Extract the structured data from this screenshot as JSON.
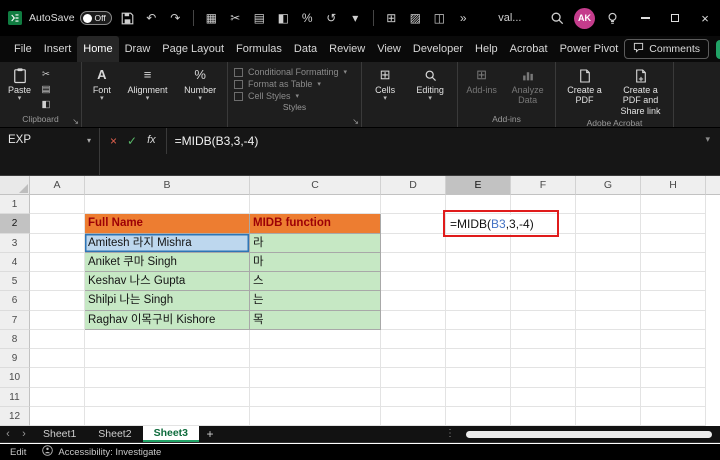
{
  "window": {
    "title": "val...",
    "autosave_label": "AutoSave",
    "autosave_state": "Off",
    "avatar_initials": "AK"
  },
  "menubar": {
    "items": [
      "File",
      "Insert",
      "Home",
      "Draw",
      "Page Layout",
      "Formulas",
      "Data",
      "Review",
      "View",
      "Developer",
      "Help",
      "Acrobat",
      "Power Pivot"
    ],
    "active": "Home",
    "comments": "Comments"
  },
  "ribbon": {
    "paste": "Paste",
    "font": "Font",
    "alignment": "Alignment",
    "number": "Number",
    "conditional_formatting": "Conditional Formatting",
    "format_as_table": "Format as Table",
    "cell_styles": "Cell Styles",
    "cells": "Cells",
    "editing": "Editing",
    "addins": "Add-ins",
    "analyze_data": "Analyze Data",
    "create_pdf": "Create a PDF",
    "create_pdf_share": "Create a PDF and Share link",
    "group_clipboard": "Clipboard",
    "group_styles": "Styles",
    "group_addins": "Add-ins",
    "group_adobe": "Adobe Acrobat"
  },
  "formula_bar": {
    "name_box": "EXP",
    "fx_label": "fx",
    "formula": "=MIDB(B3,3,-4)"
  },
  "grid": {
    "columns": [
      "A",
      "B",
      "C",
      "D",
      "E",
      "F",
      "G",
      "H"
    ],
    "row_count": 12,
    "active_column": "E",
    "active_row": 2,
    "cells": {
      "B2": {
        "text": "Full Name",
        "style": "header"
      },
      "C2": {
        "text": "MIDB function",
        "style": "header"
      },
      "B3": {
        "text": "Amitesh 라지 Mishra",
        "style": "ref"
      },
      "C3": {
        "text": "라",
        "style": "data"
      },
      "B4": {
        "text": "Aniket 쿠마 Singh",
        "style": "data"
      },
      "C4": {
        "text": "마",
        "style": "data"
      },
      "B5": {
        "text": "Keshav 나스 Gupta",
        "style": "data"
      },
      "C5": {
        "text": "스",
        "style": "data"
      },
      "B6": {
        "text": "Shilpi 나는 Singh",
        "style": "data"
      },
      "C6": {
        "text": "는",
        "style": "data"
      },
      "B7": {
        "text": "Raghav 이목구비 Kishore",
        "style": "data"
      },
      "C7": {
        "text": "목",
        "style": "data"
      }
    },
    "edit_cell": {
      "ref": "E2",
      "prefix": "=MIDB(",
      "reference": "B3",
      "suffix": ",3,-4)"
    }
  },
  "sheet_bar": {
    "tabs": [
      "Sheet1",
      "Sheet2",
      "Sheet3"
    ],
    "active": "Sheet3"
  },
  "status_bar": {
    "mode": "Edit",
    "accessibility": "Accessibility: Investigate"
  },
  "icons": {
    "dropdown": "▾",
    "more": "»",
    "undo": "↶",
    "redo": "↷",
    "table": "▦",
    "cut": "✂",
    "copy": "▤",
    "format_painter": "◧",
    "percent": "%",
    "clear": "↺",
    "borders": "⊞",
    "fill_color": "▨",
    "merge": "◫",
    "dots_vertical": "⋮",
    "prev": "‹",
    "next": "›",
    "add": "+",
    "close": "×",
    "check": "✓",
    "cancel": "×",
    "align": "≡",
    "font": "A",
    "cells": "⊞",
    "addins": "⊞",
    "launcher": "↘"
  },
  "colors": {
    "header_fill": "#ED7D31",
    "header_text": "#9C0006",
    "data_fill": "#C6E8C4",
    "ref_fill": "#BDD7EE",
    "ref_border": "#2E75B6",
    "reference_text": "#4472C4",
    "annotation_red": "#E01B1B",
    "excel_green": "#21A366",
    "avatar_bg": "#C43C8C"
  }
}
